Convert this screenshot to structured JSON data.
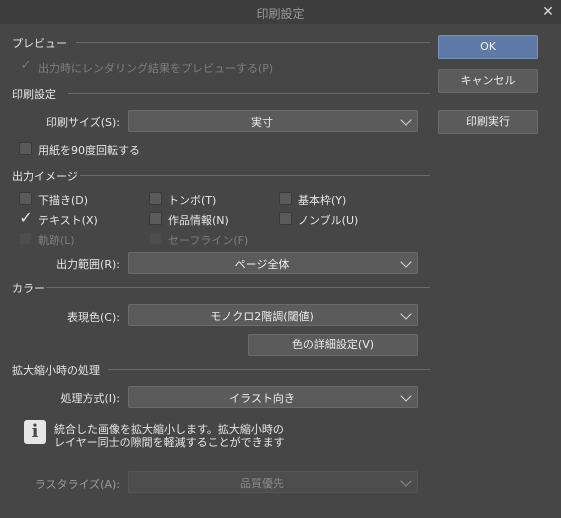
{
  "window": {
    "title": "印刷設定",
    "close_glyph": "✕"
  },
  "buttons": {
    "ok": "OK",
    "cancel": "キャンセル",
    "print": "印刷実行"
  },
  "preview": {
    "heading": "プレビュー",
    "render_preview": {
      "label": "出力時にレンダリング結果をプレビューする(P)",
      "checked": true,
      "enabled": false
    }
  },
  "print_settings": {
    "heading": "印刷設定",
    "print_size": {
      "label": "印刷サイズ(S):",
      "value": "実寸"
    },
    "rotate_90": {
      "label": "用紙を90度回転する",
      "checked": false
    }
  },
  "output_image": {
    "heading": "出力イメージ",
    "checkboxes": {
      "draft": {
        "label": "下描き(D)",
        "checked": false
      },
      "tombo": {
        "label": "トンボ(T)",
        "checked": false
      },
      "basic_frame": {
        "label": "基本枠(Y)",
        "checked": false
      },
      "text": {
        "label": "テキスト(X)",
        "checked": true
      },
      "work_info": {
        "label": "作品情報(N)",
        "checked": false
      },
      "nombre": {
        "label": "ノンブル(U)",
        "checked": false
      },
      "trace": {
        "label": "軌跡(L)",
        "checked": false,
        "enabled": false
      },
      "safe_line": {
        "label": "セーフライン(F)",
        "checked": false,
        "enabled": false
      }
    },
    "output_range": {
      "label": "出力範囲(R):",
      "value": "ページ全体"
    }
  },
  "color": {
    "heading": "カラー",
    "expression": {
      "label": "表現色(C):",
      "value": "モノクロ2階調(閾値)"
    },
    "detail_button": "色の詳細設定(V)"
  },
  "scaling": {
    "heading": "拡大縮小時の処理",
    "method": {
      "label": "処理方式(I):",
      "value": "イラスト向き"
    },
    "info_glyph": "i",
    "info_line1": "統合した画像を拡大縮小します。拡大縮小時の",
    "info_line2": "レイヤー同士の隙間を軽減することができます",
    "rasterize": {
      "label": "ラスタライズ(A):",
      "value": "品質優先",
      "enabled": false
    }
  },
  "icons": {
    "checkmark": "✓"
  }
}
